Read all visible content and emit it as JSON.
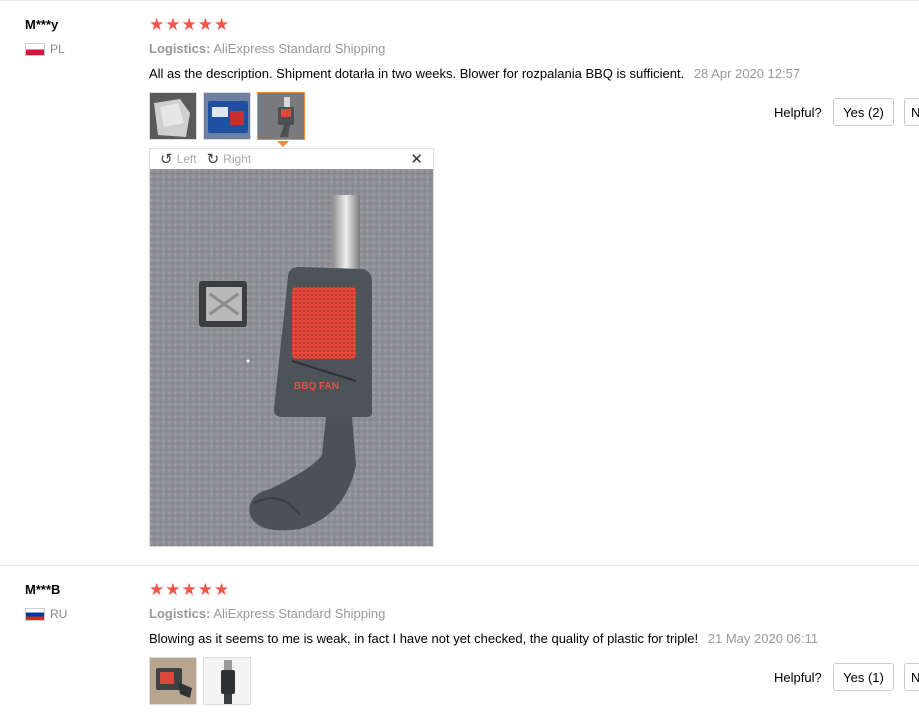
{
  "reviews": [
    {
      "user": "M***y",
      "country": "PL",
      "stars": "★★★★★",
      "logistics_label": "Logistics:",
      "logistics_value": "AliExpress Standard Shipping",
      "comment": "All as the description. Shipment dotarła in two weeks. Blower for rozpalania BBQ is sufficient.",
      "date": "28 Apr 2020 12:57",
      "helpful_label": "Helpful?",
      "yes_label": "Yes (2)",
      "no_label": "N",
      "viewer": {
        "left_label": "Left",
        "right_label": "Right",
        "close": "✕",
        "rotate_left_icon": "↺",
        "rotate_right_icon": "↻"
      }
    },
    {
      "user": "M***B",
      "country": "RU",
      "stars": "★★★★★",
      "logistics_label": "Logistics:",
      "logistics_value": "AliExpress Standard Shipping",
      "comment": "Blowing as it seems to me is weak, in fact I have not yet checked, the quality of plastic for triple!",
      "date": "21 May 2020 06:11",
      "helpful_label": "Helpful?",
      "yes_label": "Yes (1)",
      "no_label": "N"
    }
  ],
  "colors": {
    "star": "#f5544b",
    "accent_border": "#f08c3a",
    "muted_text": "#999999"
  }
}
